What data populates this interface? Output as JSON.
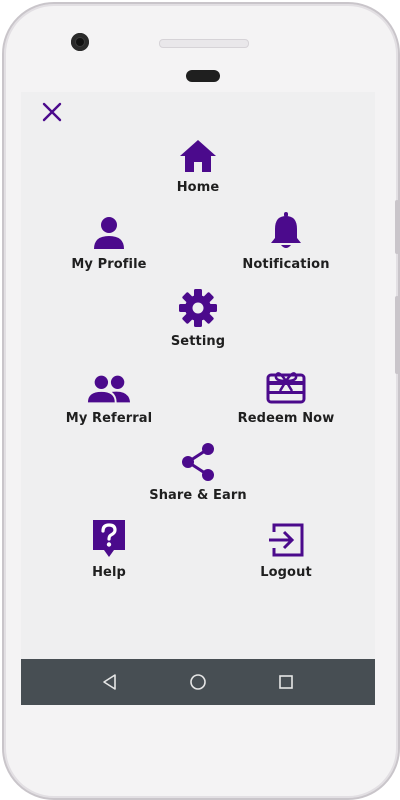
{
  "app": {
    "close_icon": "close-icon",
    "accent_color": "#4b0a8c"
  },
  "menu": {
    "items": [
      {
        "label": "Home",
        "icon": "home-icon"
      },
      {
        "label": "My Profile",
        "icon": "person-icon"
      },
      {
        "label": "Notification",
        "icon": "bell-icon"
      },
      {
        "label": "Setting",
        "icon": "gear-icon"
      },
      {
        "label": "My Referral",
        "icon": "people-icon"
      },
      {
        "label": "Redeem Now",
        "icon": "gift-card-icon"
      },
      {
        "label": "Share & Earn",
        "icon": "share-icon"
      },
      {
        "label": "Help",
        "icon": "help-icon"
      },
      {
        "label": "Logout",
        "icon": "logout-icon"
      }
    ]
  },
  "system_nav": {
    "back_icon": "back-triangle-icon",
    "home_icon": "home-circle-icon",
    "recents_icon": "recents-square-icon",
    "bar_color": "#474e53"
  }
}
